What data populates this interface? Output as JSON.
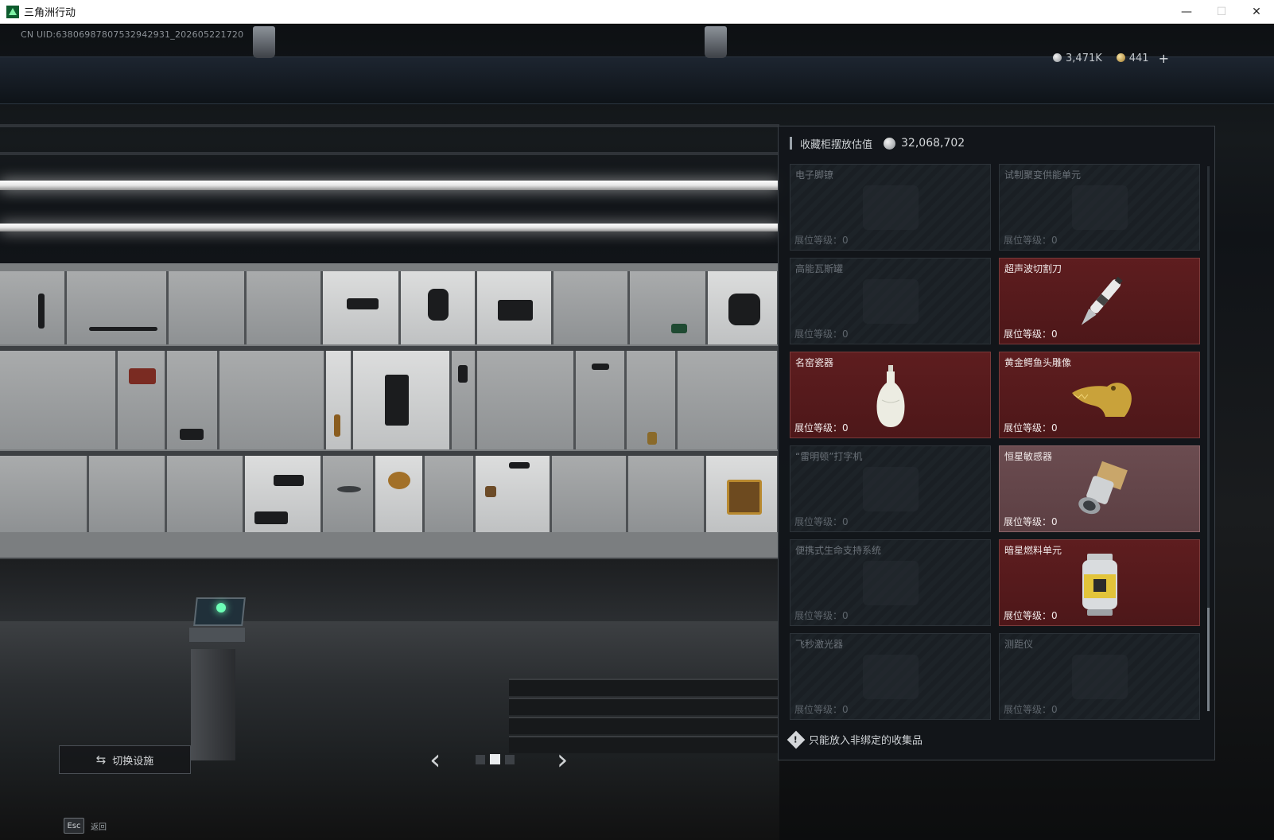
{
  "window": {
    "title": "三角洲行动",
    "minimize": "—",
    "maximize": "☐",
    "close": "✕"
  },
  "hud": {
    "uid": "CN UID:63806987807532942931_202605221720",
    "currency": [
      {
        "icon": "silver-coin-icon",
        "value": "3,471K"
      },
      {
        "icon": "gold-coin-icon",
        "value": "441"
      }
    ],
    "plus": "+"
  },
  "panel": {
    "title": "收藏柜摆放估值",
    "value": "32,068,702",
    "level_label": "展位等级：",
    "slots": [
      {
        "name": "电子脚镣",
        "level": "0",
        "state": "empty"
      },
      {
        "name": "试制聚变供能单元",
        "level": "0",
        "state": "empty"
      },
      {
        "name": "高能瓦斯罐",
        "level": "0",
        "state": "empty"
      },
      {
        "name": "超声波切割刀",
        "level": "0",
        "state": "filled",
        "art": "ultrasonic-cutter"
      },
      {
        "name": "名窑瓷器",
        "level": "0",
        "state": "filled",
        "art": "porcelain-vase"
      },
      {
        "name": "黄金鳄鱼头雕像",
        "level": "0",
        "state": "filled",
        "art": "gold-crocodile"
      },
      {
        "name": "“雷明顿”打字机",
        "level": "0",
        "state": "empty"
      },
      {
        "name": "恒星敏感器",
        "level": "0",
        "state": "filled-light",
        "art": "star-sensor"
      },
      {
        "name": "便携式生命支持系统",
        "level": "0",
        "state": "empty"
      },
      {
        "name": "暗星燃料单元",
        "level": "0",
        "state": "filled",
        "art": "fuel-cell"
      },
      {
        "name": "飞秒激光器",
        "level": "0",
        "state": "empty"
      },
      {
        "name": "测距仪",
        "level": "0",
        "state": "empty"
      }
    ],
    "notice": "只能放入非绑定的收集品"
  },
  "controls": {
    "switch_label": "切换设施",
    "prev": "‹",
    "next": "›",
    "esc_key": "Esc",
    "esc_label": "返回"
  }
}
